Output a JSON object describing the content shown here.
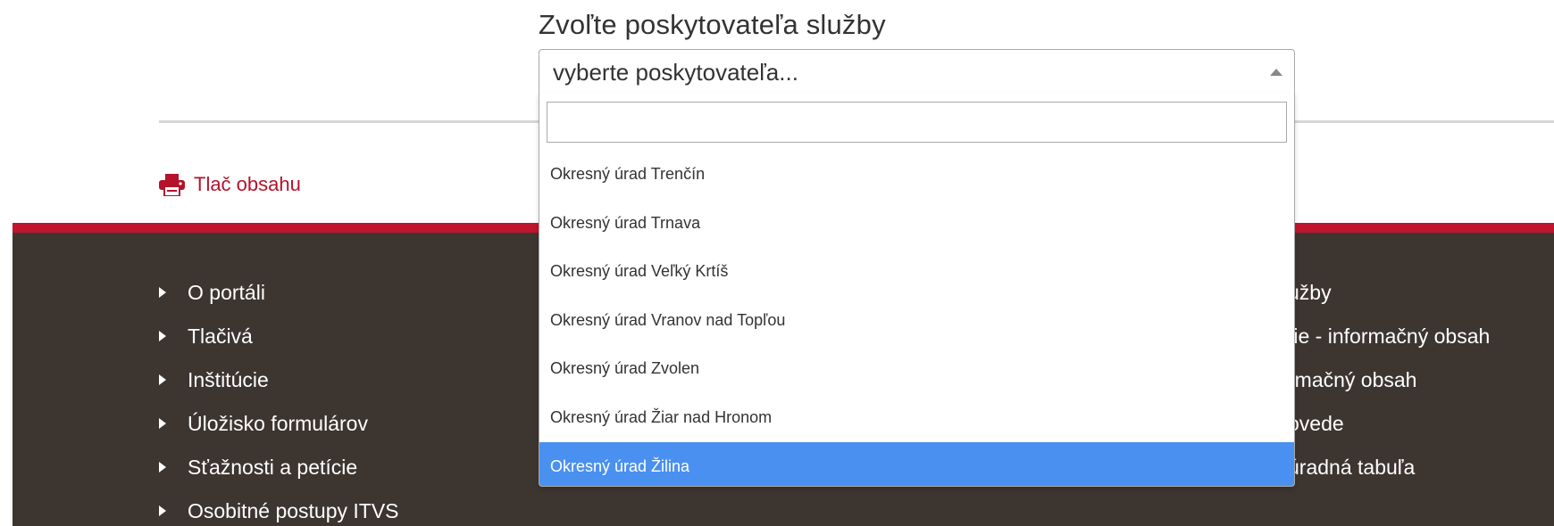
{
  "field": {
    "label": "Zvoľte poskytovateľa služby",
    "selected_placeholder": "vyberte poskytovateľa..."
  },
  "dropdown": {
    "search_value": "",
    "options": [
      "Okresný úrad Trenčín",
      "Okresný úrad Trnava",
      "Okresný úrad Veľký Krtíš",
      "Okresný úrad Vranov nad Topľou",
      "Okresný úrad Zvolen",
      "Okresný úrad Žiar nad Hronom",
      "Okresný úrad Žilina"
    ],
    "highlighted_index": 6
  },
  "print": {
    "label": "Tlač obsahu",
    "icon": "printer-icon"
  },
  "footer": {
    "left_links": [
      "O portáli",
      "Tlačivá",
      "Inštitúcie",
      "Úložisko formulárov",
      "Sťažnosti a petície",
      "Osobitné postupy ITVS"
    ],
    "right_links": [
      "užby",
      "tie - informačný obsah",
      "rmačný obsah",
      "ovede",
      "úradná tabuľa"
    ]
  },
  "colors": {
    "accent_red": "#c0162d",
    "link_red": "#b5132b",
    "footer_bg": "#3d3530",
    "highlight_blue": "#4a90f0"
  }
}
